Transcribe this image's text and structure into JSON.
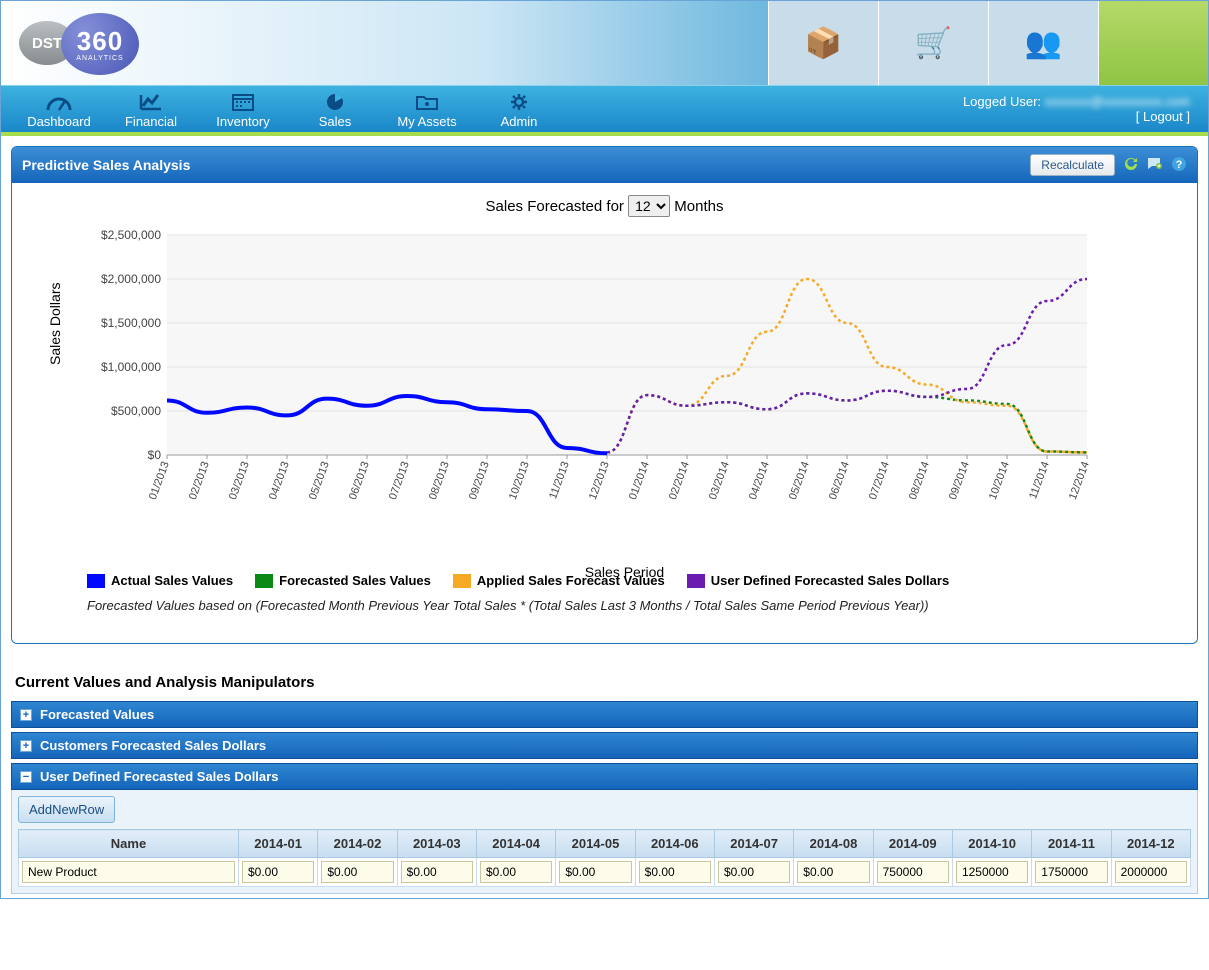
{
  "brand": {
    "gray": "DST",
    "blue_big": "360",
    "blue_small": "ANALYTICS"
  },
  "nav": {
    "items": [
      {
        "label": "Dashboard",
        "icon": "gauge"
      },
      {
        "label": "Financial",
        "icon": "chart-line"
      },
      {
        "label": "Inventory",
        "icon": "calendar"
      },
      {
        "label": "Sales",
        "icon": "pie"
      },
      {
        "label": "My Assets",
        "icon": "folder"
      },
      {
        "label": "Admin",
        "icon": "gear"
      }
    ],
    "logged_prefix": "Logged User: ",
    "logged_user_masked": "xxxxxxx@xxxxxxxxx.com",
    "logout": "[ Logout ]"
  },
  "panel": {
    "title": "Predictive Sales Analysis",
    "recalc": "Recalculate",
    "forecast_label_pre": "Sales Forecasted for ",
    "forecast_label_post": " Months",
    "forecast_months": "12",
    "ylabel": "Sales Dollars",
    "xlabel": "Sales Period",
    "formula": "Forecasted Values based on (Forecasted Month Previous Year Total Sales * (Total Sales Last 3 Months / Total Sales Same Period Previous Year))"
  },
  "legend": [
    {
      "color": "#0008ff",
      "label": "Actual Sales Values"
    },
    {
      "color": "#0a8a14",
      "label": "Forecasted Sales Values"
    },
    {
      "color": "#f6a923",
      "label": "Applied Sales Forecast Values"
    },
    {
      "color": "#6b1cb0",
      "label": "User Defined Forecasted Sales Dollars"
    }
  ],
  "chart_data": {
    "type": "line",
    "xlabel": "Sales Period",
    "ylabel": "Sales Dollars",
    "ylim": [
      0,
      2500000
    ],
    "yticks": [
      0,
      500000,
      1000000,
      1500000,
      2000000,
      2500000
    ],
    "ytick_labels": [
      "$0",
      "$500,000",
      "$1,000,000",
      "$1,500,000",
      "$2,000,000",
      "$2,500,000"
    ],
    "categories": [
      "01/2013",
      "02/2013",
      "03/2013",
      "04/2013",
      "05/2013",
      "06/2013",
      "07/2013",
      "08/2013",
      "09/2013",
      "10/2013",
      "11/2013",
      "12/2013",
      "01/2014",
      "02/2014",
      "03/2014",
      "04/2014",
      "05/2014",
      "06/2014",
      "07/2014",
      "08/2014",
      "09/2014",
      "10/2014",
      "11/2014",
      "12/2014"
    ],
    "series": [
      {
        "name": "Actual Sales Values",
        "color": "#0008ff",
        "style": "solid",
        "values": [
          620000,
          480000,
          540000,
          450000,
          640000,
          560000,
          670000,
          600000,
          520000,
          500000,
          80000,
          20000,
          null,
          null,
          null,
          null,
          null,
          null,
          null,
          null,
          null,
          null,
          null,
          null
        ]
      },
      {
        "name": "Forecasted Sales Values",
        "color": "#0a8a14",
        "style": "dashed",
        "values": [
          null,
          null,
          null,
          null,
          null,
          null,
          null,
          null,
          null,
          null,
          null,
          30000,
          680000,
          560000,
          600000,
          520000,
          700000,
          620000,
          730000,
          660000,
          620000,
          580000,
          40000,
          30000
        ]
      },
      {
        "name": "Applied Sales Forecast Values",
        "color": "#f6a923",
        "style": "dashed",
        "values": [
          null,
          null,
          null,
          null,
          null,
          null,
          null,
          null,
          null,
          null,
          null,
          30000,
          680000,
          560000,
          900000,
          1400000,
          2000000,
          1500000,
          1000000,
          800000,
          600000,
          560000,
          40000,
          30000
        ]
      },
      {
        "name": "User Defined Forecasted Sales Dollars",
        "color": "#6b1cb0",
        "style": "dashed",
        "values": [
          null,
          null,
          null,
          null,
          null,
          null,
          null,
          null,
          null,
          null,
          null,
          30000,
          680000,
          560000,
          600000,
          520000,
          700000,
          620000,
          730000,
          660000,
          750000,
          1250000,
          1750000,
          2000000
        ]
      }
    ]
  },
  "section_title": "Current Values and Analysis Manipulators",
  "accordions": [
    {
      "title": "Forecasted Values",
      "open": false
    },
    {
      "title": "Customers Forecasted Sales Dollars",
      "open": false
    },
    {
      "title": "User Defined Forecasted Sales Dollars",
      "open": true
    }
  ],
  "addrow": "AddNewRow",
  "table": {
    "headers": [
      "Name",
      "2014-01",
      "2014-02",
      "2014-03",
      "2014-04",
      "2014-05",
      "2014-06",
      "2014-07",
      "2014-08",
      "2014-09",
      "2014-10",
      "2014-11",
      "2014-12"
    ],
    "rows": [
      {
        "name": "New Product",
        "values": [
          "$0.00",
          "$0.00",
          "$0.00",
          "$0.00",
          "$0.00",
          "$0.00",
          "$0.00",
          "$0.00",
          "750000",
          "1250000",
          "1750000",
          "2000000"
        ]
      }
    ]
  }
}
